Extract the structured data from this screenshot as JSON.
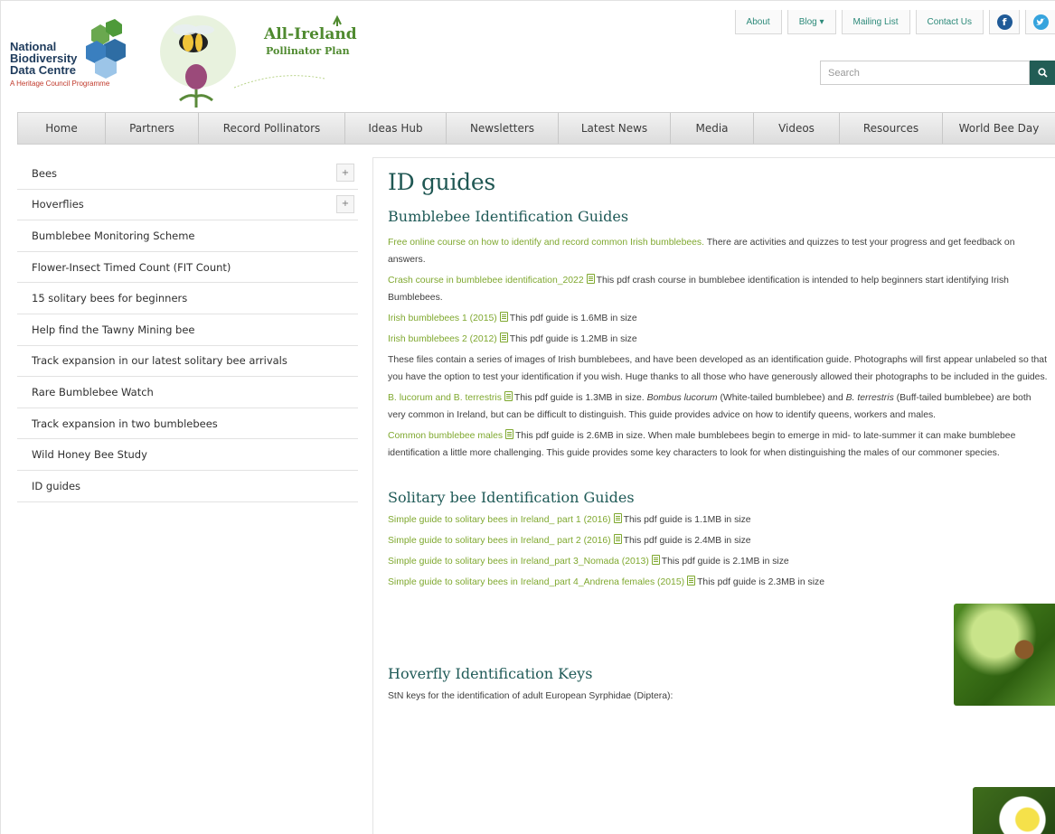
{
  "header": {
    "nbdc_lines": [
      "National",
      "Biodiversity",
      "Data Centre"
    ],
    "nbdc_sub": "A Heritage Council Programme",
    "aipp_lines": [
      "All-Ireland",
      "Pollinator Plan"
    ],
    "top_links": [
      "About",
      "Blog ▾",
      "Mailing List",
      "Contact Us"
    ],
    "social": [
      "facebook-icon",
      "twitter-icon"
    ],
    "search_placeholder": "Search"
  },
  "nav": [
    "Home",
    "Partners",
    "Record Pollinators",
    "Ideas Hub",
    "Newsletters",
    "Latest News",
    "Media",
    "Videos",
    "Resources",
    "World Bee Day"
  ],
  "sidebar": [
    {
      "label": "Bees",
      "expand": "+"
    },
    {
      "label": "Hoverflies",
      "expand": "+"
    },
    {
      "label": "Bumblebee Monitoring Scheme"
    },
    {
      "label": "Flower-Insect Timed Count (FIT Count)"
    },
    {
      "label": "15 solitary bees for beginners"
    },
    {
      "label": "Help find the Tawny Mining bee"
    },
    {
      "label": "Track expansion in our latest solitary bee arrivals"
    },
    {
      "label": "Rare Bumblebee Watch"
    },
    {
      "label": "Track expansion in two bumblebees"
    },
    {
      "label": "Wild Honey Bee Study"
    },
    {
      "label": "ID guides"
    }
  ],
  "main": {
    "title": "ID guides",
    "bumblebee": {
      "heading": "Bumblebee Identification Guides",
      "course_link": "Free online course on how to identify and record common Irish bumblebees.",
      "course_text": " There are activities and quizzes to test your progress and get feedback on answers.",
      "crash_link": "Crash course in bumblebee identification_2022",
      "crash_text": "This pdf crash course in bumblebee identification is intended to help beginners start identifying Irish Bumblebees.",
      "irish1_link": "Irish bumblebees 1 (2015)",
      "irish1_text": "This pdf guide is 1.6MB in size",
      "irish2_link": "Irish bumblebees 2 (2012)",
      "irish2_text": "This pdf guide is 1.2MB in size",
      "files_text": "These files contain a series of images of Irish bumblebees, and have been developed as an identification guide.  Photographs will first appear unlabeled so that you have the option to test your identification if you wish.  Huge thanks to all those who have generously allowed their photographs to be included in the guides.",
      "lucorum_link": "B. lucorum and B. terrestris",
      "lucorum_text_a": "This pdf guide is 1.3MB in size. ",
      "lucorum_em1": "Bombus lucorum",
      "lucorum_text_b": " (White-tailed bumblebee) and ",
      "lucorum_em2": "B. terrestris",
      "lucorum_text_c": " (Buff-tailed bumblebee) are both very common in Ireland, but can be difficult to distinguish. This guide provides advice on how to identify queens, workers and males.",
      "males_link": "Common bumblebee males",
      "males_text": "This pdf guide is 2.6MB in size.  When male bumblebees begin to emerge in mid- to late-summer it can make bumblebee identification a little more challenging.  This guide provides some key characters to look for when distinguishing the males of our commoner species."
    },
    "solitary": {
      "heading": "Solitary bee Identification Guides",
      "items": [
        {
          "link": "Simple guide to solitary bees in Ireland_ part 1 (2016)",
          "text": "This pdf guide is 1.1MB in size"
        },
        {
          "link": "Simple guide to solitary bees in Ireland_ part 2 (2016)",
          "text": "This pdf guide is 2.4MB in size"
        },
        {
          "link": "Simple guide to solitary bees in Ireland_part 3_Nomada (2013)",
          "text": "This pdf guide is 2.1MB in size"
        },
        {
          "link": "Simple guide to solitary bees in Ireland_part 4_Andrena females (2015)",
          "text": "This pdf guide is 2.3MB in size"
        }
      ]
    },
    "hoverfly": {
      "heading": "Hoverfly Identification Keys",
      "text": "StN keys for the identification of adult European Syrphidae (Diptera):"
    }
  }
}
